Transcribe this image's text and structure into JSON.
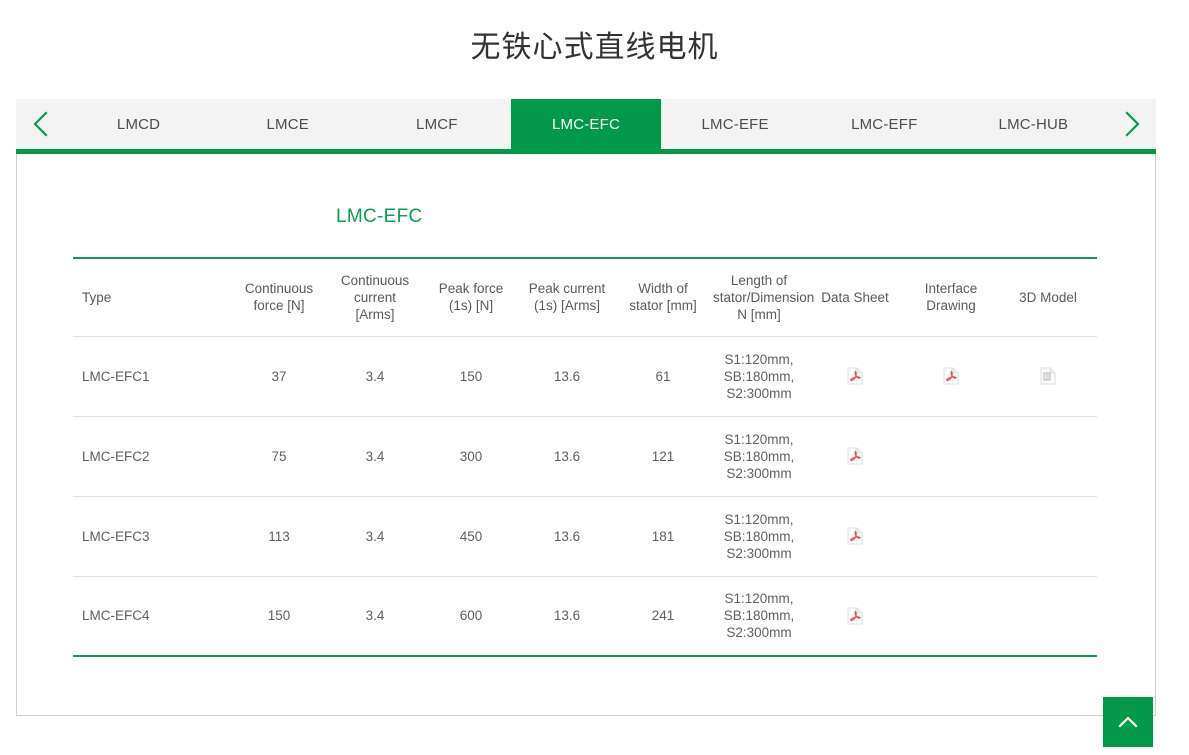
{
  "page": {
    "title": "无铁心式直线电机"
  },
  "colors": {
    "brand_green": "#03994a",
    "heading_green": "#0aa050",
    "tab_bar_bg": "#f3f3f3",
    "pdf_red": "#e8453c",
    "text_gray": "#5a5a5a"
  },
  "tabbar": {
    "prev_icon": "chevron-left-icon",
    "next_icon": "chevron-right-icon",
    "active_index": 3,
    "tabs": [
      {
        "label": "LMCD"
      },
      {
        "label": "LMCE"
      },
      {
        "label": "LMCF"
      },
      {
        "label": "LMC-EFC"
      },
      {
        "label": "LMC-EFE"
      },
      {
        "label": "LMC-EFF"
      },
      {
        "label": "LMC-HUB"
      }
    ]
  },
  "content": {
    "section_title": "LMC-EFC",
    "table": {
      "headers": [
        "Type",
        "Continuous\nforce [N]",
        "Continuous\ncurrent\n[Arms]",
        "Peak force\n(1s) [N]",
        "Peak current\n(1s) [Arms]",
        "Width of\nstator [mm]",
        "Length of\nstator/Dimension\nN [mm]",
        "Data Sheet",
        "Interface\nDrawing",
        "3D Model"
      ],
      "rows": [
        {
          "type": "LMC-EFC1",
          "continuous_force": "37",
          "continuous_current": "3.4",
          "peak_force": "150",
          "peak_current": "13.6",
          "width_of_stator": "61",
          "length_of_stator": "S1:120mm,\nSB:180mm,\nS2:300mm",
          "data_sheet": "pdf-file-icon",
          "interface_drawing": "pdf-file-icon",
          "model_3d": "3d-model-file-icon"
        },
        {
          "type": "LMC-EFC2",
          "continuous_force": "75",
          "continuous_current": "3.4",
          "peak_force": "300",
          "peak_current": "13.6",
          "width_of_stator": "121",
          "length_of_stator": "S1:120mm,\nSB:180mm,\nS2:300mm",
          "data_sheet": "pdf-file-icon",
          "interface_drawing": "",
          "model_3d": ""
        },
        {
          "type": "LMC-EFC3",
          "continuous_force": "113",
          "continuous_current": "3.4",
          "peak_force": "450",
          "peak_current": "13.6",
          "width_of_stator": "181",
          "length_of_stator": "S1:120mm,\nSB:180mm,\nS2:300mm",
          "data_sheet": "pdf-file-icon",
          "interface_drawing": "",
          "model_3d": ""
        },
        {
          "type": "LMC-EFC4",
          "continuous_force": "150",
          "continuous_current": "3.4",
          "peak_force": "600",
          "peak_current": "13.6",
          "width_of_stator": "241",
          "length_of_stator": "S1:120mm,\nSB:180mm,\nS2:300mm",
          "data_sheet": "pdf-file-icon",
          "interface_drawing": "",
          "model_3d": ""
        }
      ]
    }
  },
  "back_to_top": {
    "icon": "chevron-up-icon"
  }
}
